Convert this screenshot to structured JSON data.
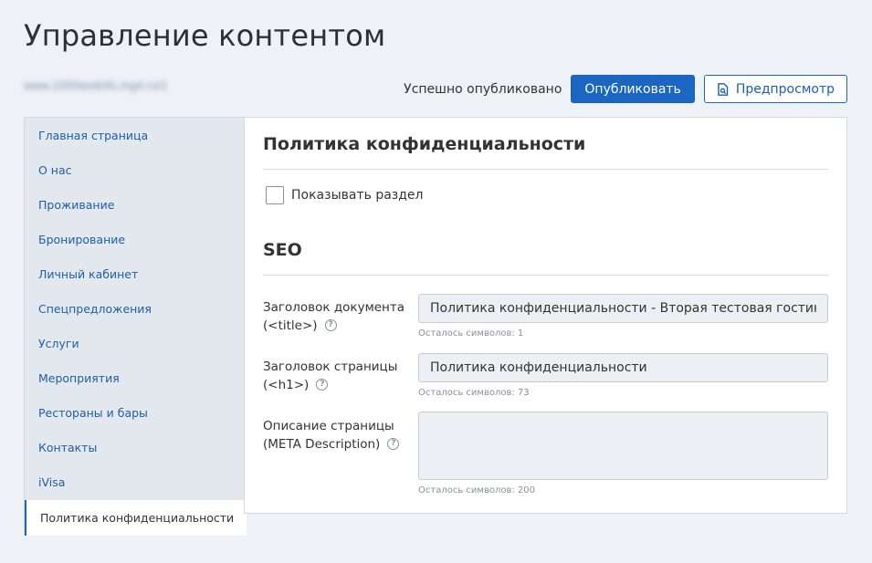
{
  "header": {
    "title": "Управление контентом",
    "site_url": "www.1000testinfo.mgrt.ru/1"
  },
  "toolbar": {
    "status": "Успешно опубликовано",
    "publish_label": "Опубликовать",
    "preview_label": "Предпросмотр"
  },
  "sidebar": {
    "items": [
      {
        "label": "Главная страница"
      },
      {
        "label": "О нас"
      },
      {
        "label": "Проживание"
      },
      {
        "label": "Бронирование"
      },
      {
        "label": "Личный кабинет"
      },
      {
        "label": "Спецпредложения"
      },
      {
        "label": "Услуги"
      },
      {
        "label": "Мероприятия"
      },
      {
        "label": "Рестораны и бары"
      },
      {
        "label": "Контакты"
      },
      {
        "label": "iVisa"
      },
      {
        "label": "Политика конфиденциальности",
        "active": true
      }
    ]
  },
  "main": {
    "section_title": "Политика конфиденциальности",
    "show_section_label": "Показывать раздел",
    "show_section_checked": false,
    "seo_title": "SEO",
    "fields": {
      "doc_title": {
        "label": "Заголовок документа (<title>)",
        "value": "Политика конфиденциальности - Вторая тестовая гостиница",
        "counter": "Осталось символов: 1"
      },
      "page_h1": {
        "label": "Заголовок страницы (<h1>)",
        "value": "Политика конфиденциальности",
        "counter": "Осталось символов: 73"
      },
      "meta_description": {
        "label": "Описание страницы (META Description)",
        "value": "",
        "counter": "Осталось символов: 200"
      }
    }
  },
  "icons": {
    "help": "question-circle-icon",
    "preview": "document-preview-icon",
    "help_glyph": "?"
  },
  "colors": {
    "accent": "#1a66c2",
    "background": "#eef1f5",
    "sidebar_bg": "#e3e7ee",
    "link": "#1d5fa8"
  }
}
